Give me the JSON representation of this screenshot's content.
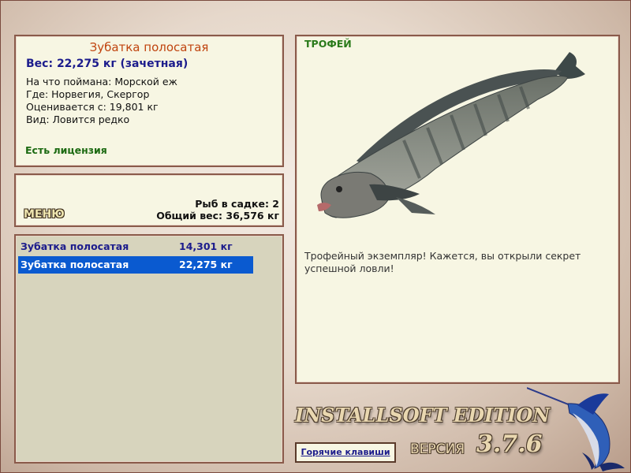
{
  "info": {
    "fish_name": "Зубатка полосатая",
    "weight": "Вес: 22,275 кг (зачетная)",
    "caught_on": "На что поймана: Морской еж",
    "where": "Где: Норвегия, Скергор",
    "rated_from": "Оценивается с: 19,801 кг",
    "type": "Вид: Ловится редко",
    "license": "Есть лицензия"
  },
  "menu": {
    "button_label": "МЕНЮ",
    "fish_in_cage": "Рыб в садке: 2",
    "total_weight": "Общий вес: 36,576 кг"
  },
  "catch_list": [
    {
      "name": "Зубатка полосатая",
      "weight": "14,301 кг",
      "selected": false
    },
    {
      "name": "Зубатка полосатая",
      "weight": "22,275 кг",
      "selected": true
    }
  ],
  "trophy": {
    "label": "ТРОФЕЙ",
    "message": "Трофейный экземпляр! Кажется, вы открыли секрет успешной ловли!",
    "image": "striped-wolffish-image"
  },
  "footer": {
    "brand": "INSTALLSOFT EDITION",
    "version_label": "ВЕРСИЯ",
    "version_number": "3.7.6",
    "hotkeys_label": "Горячие клавиши",
    "logo": "marlin-logo"
  },
  "colors": {
    "panel_bg": "#f7f6e3",
    "panel_border": "#8a5a4a",
    "fish_title": "#c0440f",
    "weight_text": "#1c1c8c",
    "license_text": "#1c6a12",
    "selection": "#0a5ad0",
    "trophy_label": "#2a7a1a"
  }
}
